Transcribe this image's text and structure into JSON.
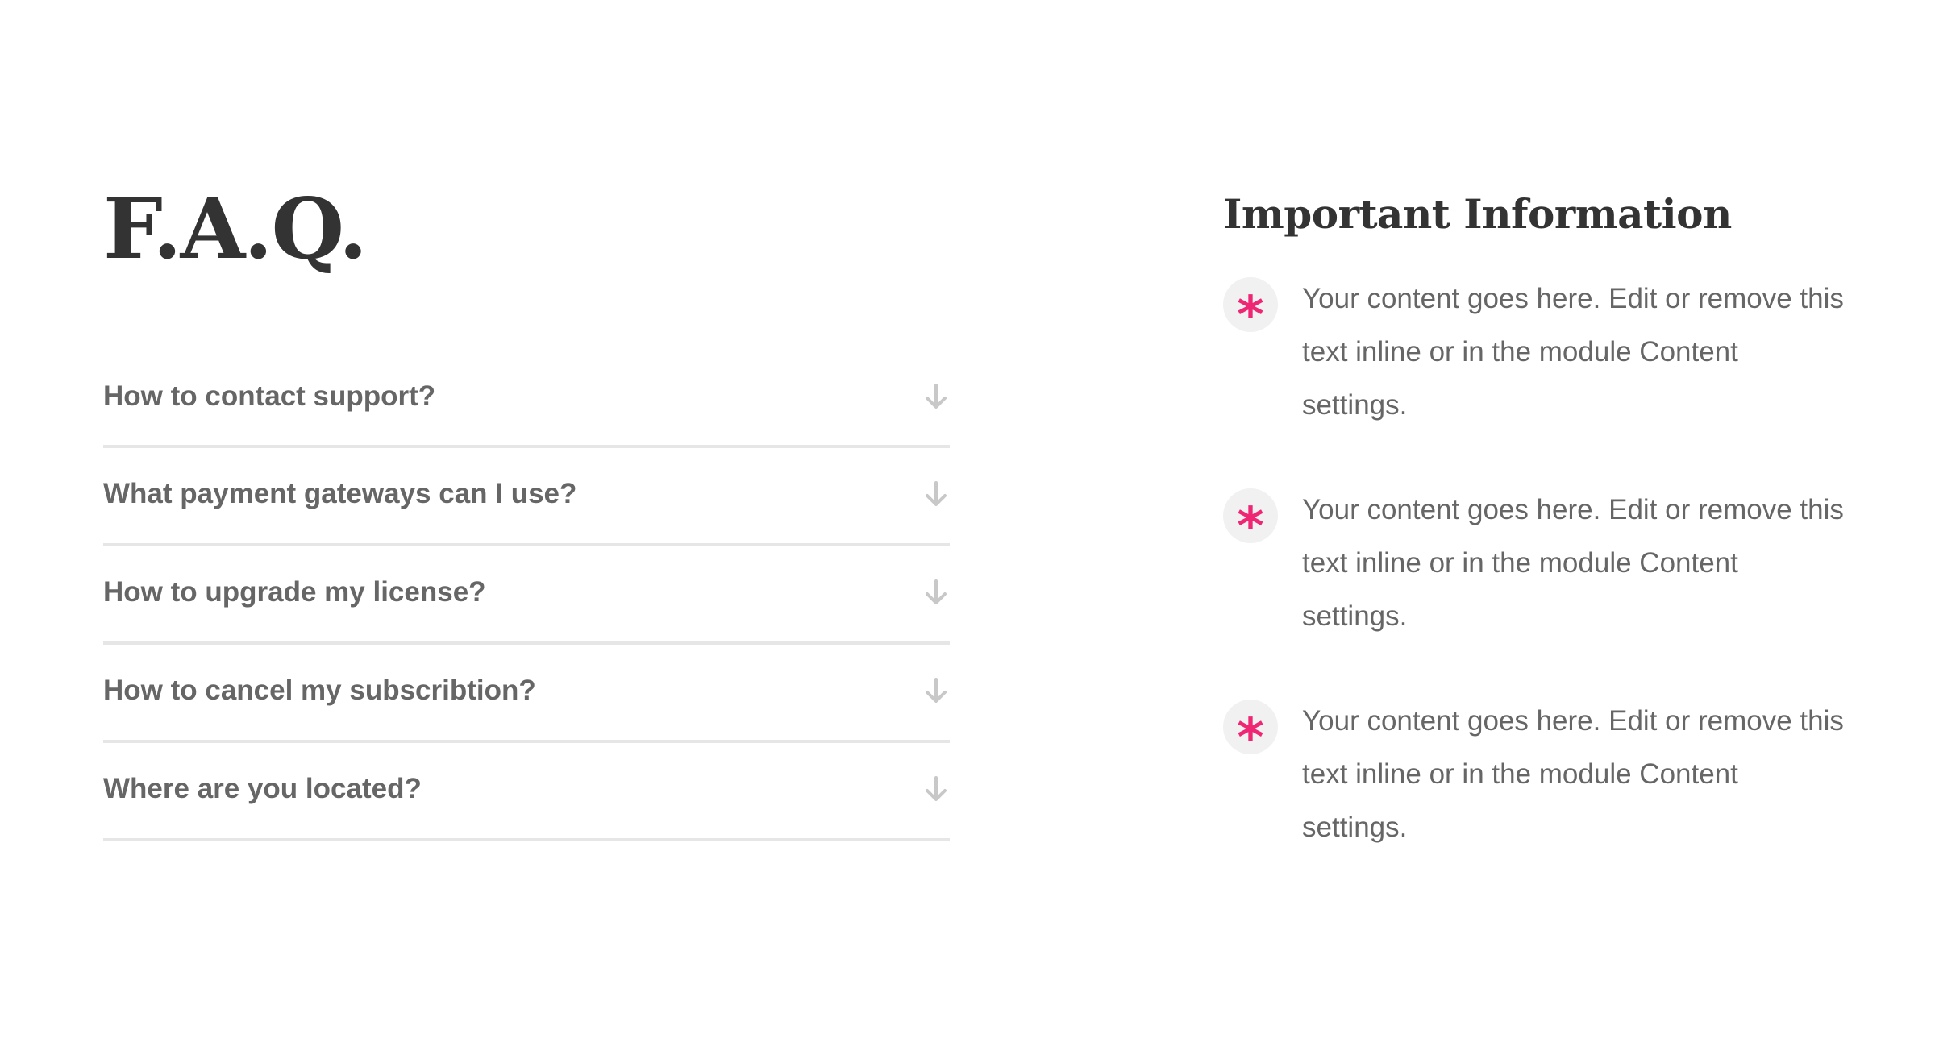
{
  "faq": {
    "title": "F.A.Q.",
    "items": [
      {
        "question": "How to contact support?",
        "icon": "arrow-down-icon"
      },
      {
        "question": "What payment gateways can I use?",
        "icon": "arrow-down-icon"
      },
      {
        "question": "How to upgrade my license?",
        "icon": "arrow-down-icon"
      },
      {
        "question": "How to cancel my subscribtion?",
        "icon": "arrow-down-icon"
      },
      {
        "question": "Where are you located?",
        "icon": "arrow-down-icon"
      }
    ]
  },
  "info": {
    "title": "Important Information",
    "items": [
      {
        "icon": "asterisk-icon",
        "text": "Your content goes here. Edit or remove this text inline or in the module Content settings."
      },
      {
        "icon": "asterisk-icon",
        "text": "Your content goes here. Edit or remove this text inline or in the module Content settings."
      },
      {
        "icon": "asterisk-icon",
        "text": "Your content goes here. Edit or remove this text inline or in the module Content settings."
      }
    ]
  },
  "colors": {
    "heading": "#333333",
    "body_text": "#666666",
    "accent": "#ef2673",
    "divider": "#e6e6e6",
    "icon_bg": "#f1f1f1",
    "arrow": "#c8c8c8"
  }
}
